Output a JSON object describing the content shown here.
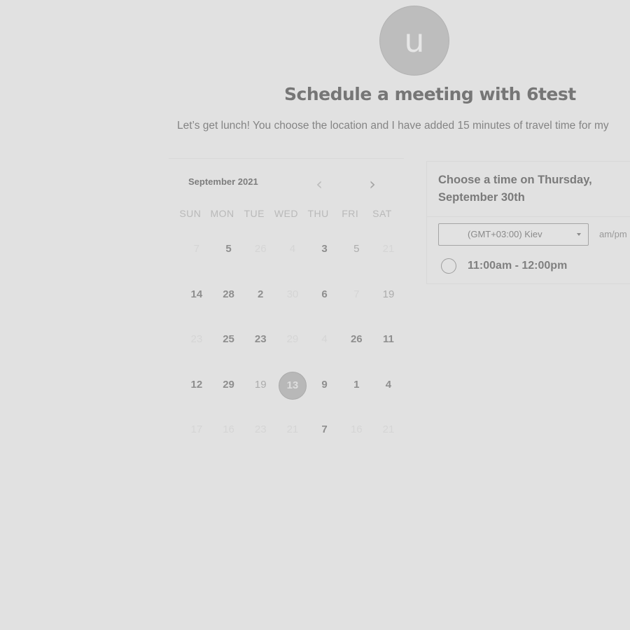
{
  "host": {
    "avatar_initial": "u",
    "title": "Schedule a meeting with 6test",
    "description": "Let’s get lunch! You choose the location and I have added 15 minutes of travel time for my"
  },
  "calendar": {
    "month_label": "September 2021",
    "prev_icon": "chevron-left-icon",
    "next_icon": "chevron-right-icon",
    "prev_glyph": "‹",
    "next_glyph": "›",
    "weekdays": [
      "SUN",
      "MON",
      "TUE",
      "WED",
      "THU",
      "FRI",
      "SAT"
    ],
    "days": [
      {
        "label": "7",
        "state": "faded"
      },
      {
        "label": "5",
        "state": "avail"
      },
      {
        "label": "26",
        "state": "faded"
      },
      {
        "label": "4",
        "state": "faded"
      },
      {
        "label": "3",
        "state": "avail"
      },
      {
        "label": "5",
        "state": "plain"
      },
      {
        "label": "21",
        "state": "faded"
      },
      {
        "label": "14",
        "state": "avail"
      },
      {
        "label": "28",
        "state": "avail"
      },
      {
        "label": "2",
        "state": "avail"
      },
      {
        "label": "30",
        "state": "faded"
      },
      {
        "label": "6",
        "state": "avail"
      },
      {
        "label": "7",
        "state": "faded"
      },
      {
        "label": "19",
        "state": "plain"
      },
      {
        "label": "23",
        "state": "faded"
      },
      {
        "label": "25",
        "state": "avail"
      },
      {
        "label": "23",
        "state": "avail"
      },
      {
        "label": "29",
        "state": "faded"
      },
      {
        "label": "4",
        "state": "faded"
      },
      {
        "label": "26",
        "state": "avail"
      },
      {
        "label": "11",
        "state": "avail"
      },
      {
        "label": "12",
        "state": "avail"
      },
      {
        "label": "29",
        "state": "avail"
      },
      {
        "label": "19",
        "state": "plain"
      },
      {
        "label": "13",
        "state": "selected"
      },
      {
        "label": "9",
        "state": "avail"
      },
      {
        "label": "1",
        "state": "avail"
      },
      {
        "label": "4",
        "state": "avail"
      },
      {
        "label": "17",
        "state": "faded"
      },
      {
        "label": "16",
        "state": "faded"
      },
      {
        "label": "23",
        "state": "faded"
      },
      {
        "label": "21",
        "state": "faded"
      },
      {
        "label": "7",
        "state": "avail"
      },
      {
        "label": "16",
        "state": "faded"
      },
      {
        "label": "21",
        "state": "faded"
      }
    ]
  },
  "time_panel": {
    "heading": "Choose a time on Thursday, September 30th",
    "timezone": "(GMT+03:00) Kiev",
    "format_toggle": "am/pm",
    "slots": [
      {
        "label": "11:00am - 12:00pm",
        "selected": false
      }
    ]
  }
}
